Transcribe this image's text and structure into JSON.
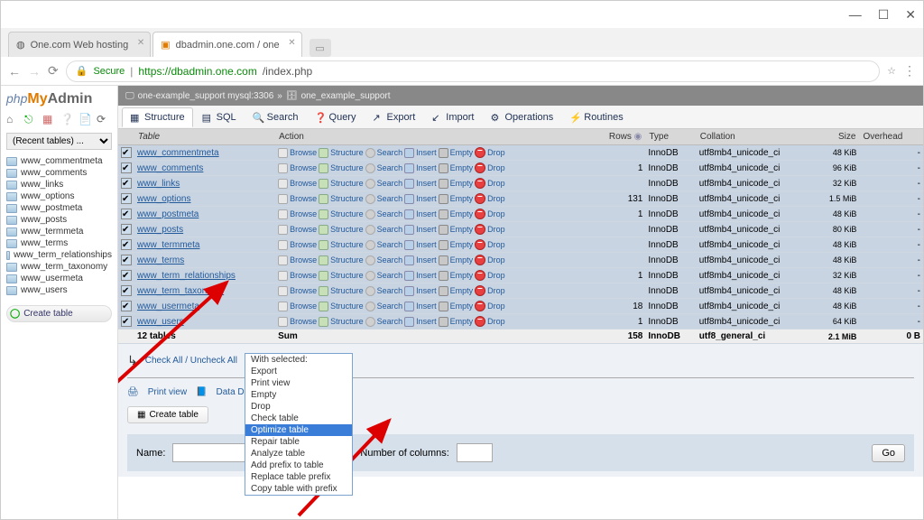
{
  "window": {
    "title_tab1": "One.com Web hosting",
    "title_tab2": "dbadmin.one.com / one"
  },
  "browser": {
    "secure_label": "Secure",
    "url_host": "https://dbadmin.one.com",
    "url_path": "/index.php"
  },
  "logo": {
    "php": "php",
    "my": "My",
    "admin": "Admin"
  },
  "recent_placeholder": "(Recent tables) ...",
  "sidebar_tables": [
    "www_commentmeta",
    "www_comments",
    "www_links",
    "www_options",
    "www_postmeta",
    "www_posts",
    "www_termmeta",
    "www_terms",
    "www_term_relationships",
    "www_term_taxonomy",
    "www_usermeta",
    "www_users"
  ],
  "sidebar_create": "Create table",
  "breadcrumb": {
    "server": "one-example_support mysql:3306",
    "db": "one_example_support"
  },
  "main_tabs": [
    "Structure",
    "SQL",
    "Search",
    "Query",
    "Export",
    "Import",
    "Operations",
    "Routines"
  ],
  "columns": {
    "table": "Table",
    "action": "Action",
    "rows": "Rows",
    "type": "Type",
    "collation": "Collation",
    "size": "Size",
    "overhead": "Overhead"
  },
  "actions": {
    "browse": "Browse",
    "structure": "Structure",
    "search": "Search",
    "insert": "Insert",
    "empty": "Empty",
    "drop": "Drop"
  },
  "rows": [
    {
      "name": "www_commentmeta",
      "rows": "",
      "type": "InnoDB",
      "collation": "utf8mb4_unicode_ci",
      "size": "48 KiB",
      "ovh": "-"
    },
    {
      "name": "www_comments",
      "rows": "1",
      "type": "InnoDB",
      "collation": "utf8mb4_unicode_ci",
      "size": "96 KiB",
      "ovh": "-"
    },
    {
      "name": "www_links",
      "rows": "",
      "type": "InnoDB",
      "collation": "utf8mb4_unicode_ci",
      "size": "32 KiB",
      "ovh": "-"
    },
    {
      "name": "www_options",
      "rows": "131",
      "type": "InnoDB",
      "collation": "utf8mb4_unicode_ci",
      "size": "1.5 MiB",
      "ovh": "-"
    },
    {
      "name": "www_postmeta",
      "rows": "1",
      "type": "InnoDB",
      "collation": "utf8mb4_unicode_ci",
      "size": "48 KiB",
      "ovh": "-"
    },
    {
      "name": "www_posts",
      "rows": "",
      "type": "InnoDB",
      "collation": "utf8mb4_unicode_ci",
      "size": "80 KiB",
      "ovh": "-"
    },
    {
      "name": "www_termmeta",
      "rows": "",
      "type": "InnoDB",
      "collation": "utf8mb4_unicode_ci",
      "size": "48 KiB",
      "ovh": "-"
    },
    {
      "name": "www_terms",
      "rows": "",
      "type": "InnoDB",
      "collation": "utf8mb4_unicode_ci",
      "size": "48 KiB",
      "ovh": "-"
    },
    {
      "name": "www_term_relationships",
      "rows": "1",
      "type": "InnoDB",
      "collation": "utf8mb4_unicode_ci",
      "size": "32 KiB",
      "ovh": "-"
    },
    {
      "name": "www_term_taxonomy",
      "rows": "",
      "type": "InnoDB",
      "collation": "utf8mb4_unicode_ci",
      "size": "48 KiB",
      "ovh": "-"
    },
    {
      "name": "www_usermeta",
      "rows": "18",
      "type": "InnoDB",
      "collation": "utf8mb4_unicode_ci",
      "size": "48 KiB",
      "ovh": "-"
    },
    {
      "name": "www_users",
      "rows": "1",
      "type": "InnoDB",
      "collation": "utf8mb4_unicode_ci",
      "size": "64 KiB",
      "ovh": "-"
    }
  ],
  "summary": {
    "label": "12 tables",
    "sum": "Sum",
    "rows": "158",
    "type": "InnoDB",
    "collation": "utf8_general_ci",
    "size": "2.1 MiB",
    "ovh": "0 B"
  },
  "checkall": {
    "label": "Check All / Uncheck All",
    "with_selected": "With selected:"
  },
  "dropdown_options": [
    "With selected:",
    "Export",
    "Print view",
    "Empty",
    "Drop",
    "Check table",
    "Optimize table",
    "Repair table",
    "Analyze table",
    "Add prefix to table",
    "Replace table prefix",
    "Copy table with prefix"
  ],
  "dropdown_selected_index": 6,
  "print_row": {
    "print": "Print view",
    "dict": "Data Dictionary"
  },
  "create_table_btn": "Create table",
  "form": {
    "name_label": "Name:",
    "cols_label": "Number of columns:",
    "go": "Go"
  }
}
